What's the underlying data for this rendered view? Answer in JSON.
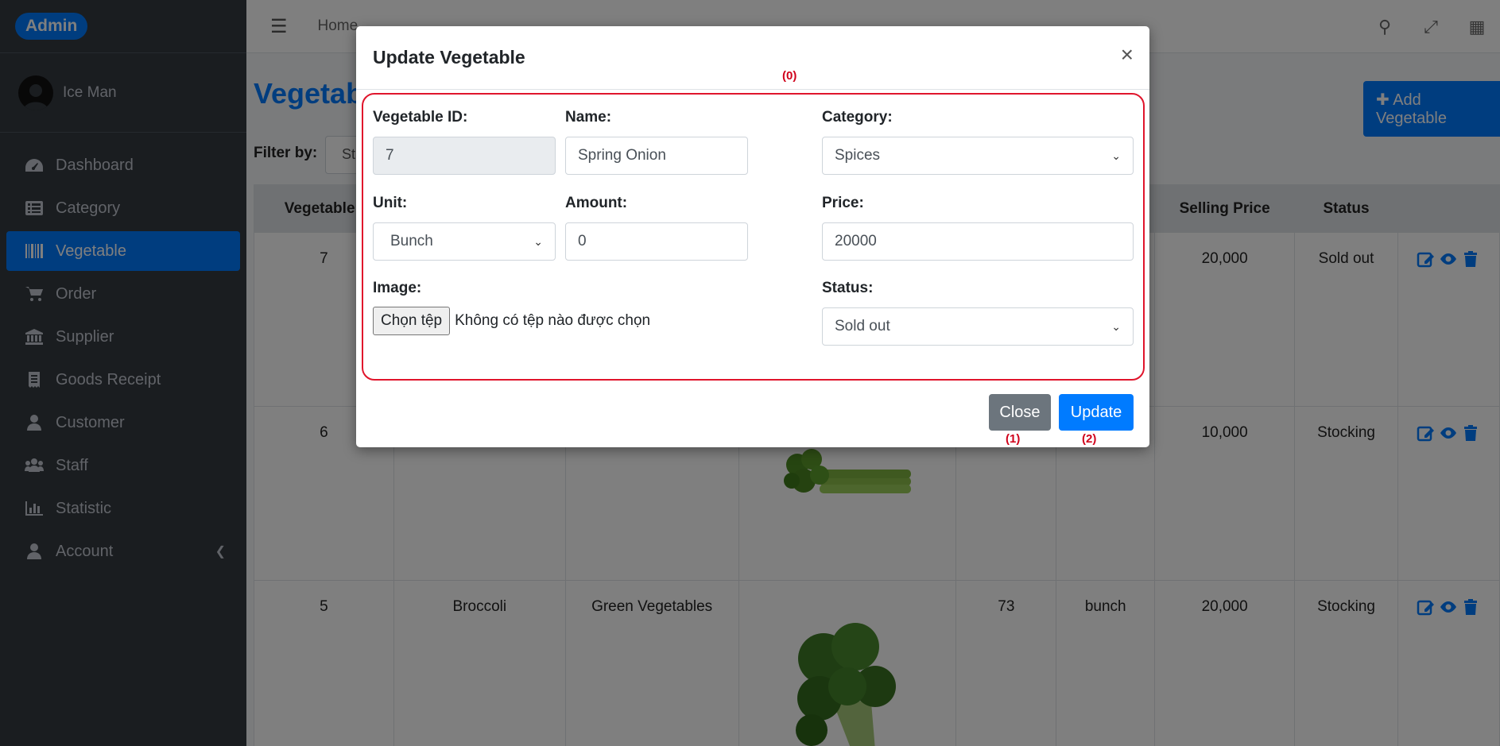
{
  "brand": {
    "label": "Admin"
  },
  "user": {
    "name": "Ice Man"
  },
  "sidebar": {
    "items": [
      {
        "label": "Dashboard",
        "icon": "tachometer-icon"
      },
      {
        "label": "Category",
        "icon": "list-icon"
      },
      {
        "label": "Vegetable",
        "icon": "barcode-icon",
        "active": true
      },
      {
        "label": "Order",
        "icon": "cart-icon"
      },
      {
        "label": "Supplier",
        "icon": "bank-icon"
      },
      {
        "label": "Goods Receipt",
        "icon": "receipt-icon"
      },
      {
        "label": "Customer",
        "icon": "user-icon"
      },
      {
        "label": "Staff",
        "icon": "users-icon"
      },
      {
        "label": "Statistic",
        "icon": "chart-icon"
      },
      {
        "label": "Account",
        "icon": "user-icon"
      }
    ]
  },
  "header": {
    "home_label": "Home"
  },
  "page": {
    "title": "Vegetabl",
    "add_button": "Add Vegetable",
    "filter_label": "Filter by:",
    "filter_value": "St"
  },
  "table": {
    "headers": [
      "Vegetable I",
      "",
      "",
      "",
      "",
      "",
      "Selling Price",
      "Status",
      ""
    ],
    "rows": [
      {
        "id": "7",
        "name": "",
        "category": "",
        "amount": "",
        "unit": "",
        "price": "20,000",
        "status": "Sold out"
      },
      {
        "id": "6",
        "name": "",
        "category": "",
        "amount": "",
        "unit": "",
        "price": "10,000",
        "status": "Stocking"
      },
      {
        "id": "5",
        "name": "Broccoli",
        "category": "Green Vegetables",
        "amount": "73",
        "unit": "bunch",
        "price": "20,000",
        "status": "Stocking"
      }
    ]
  },
  "modal": {
    "title": "Update Vegetable",
    "close_x": "×",
    "annotations": {
      "form": "(0)",
      "close": "(1)",
      "update": "(2)"
    },
    "fields": {
      "vegetable_id_label": "Vegetable ID:",
      "vegetable_id_value": "7",
      "name_label": "Name:",
      "name_value": "Spring Onion",
      "category_label": "Category:",
      "category_value": "Spices",
      "unit_label": "Unit:",
      "unit_value": "Bunch",
      "amount_label": "Amount:",
      "amount_value": "0",
      "price_label": "Price:",
      "price_value": "20000",
      "image_label": "Image:",
      "file_button": "Chọn tệp",
      "file_status": "Không có tệp nào được chọn",
      "status_label": "Status:",
      "status_value": "Sold out"
    },
    "buttons": {
      "close": "Close",
      "update": "Update"
    }
  },
  "colors": {
    "primary": "#007bff",
    "sidebar": "#343a40",
    "secondary": "#6c757d",
    "annotation": "#e0152c"
  }
}
